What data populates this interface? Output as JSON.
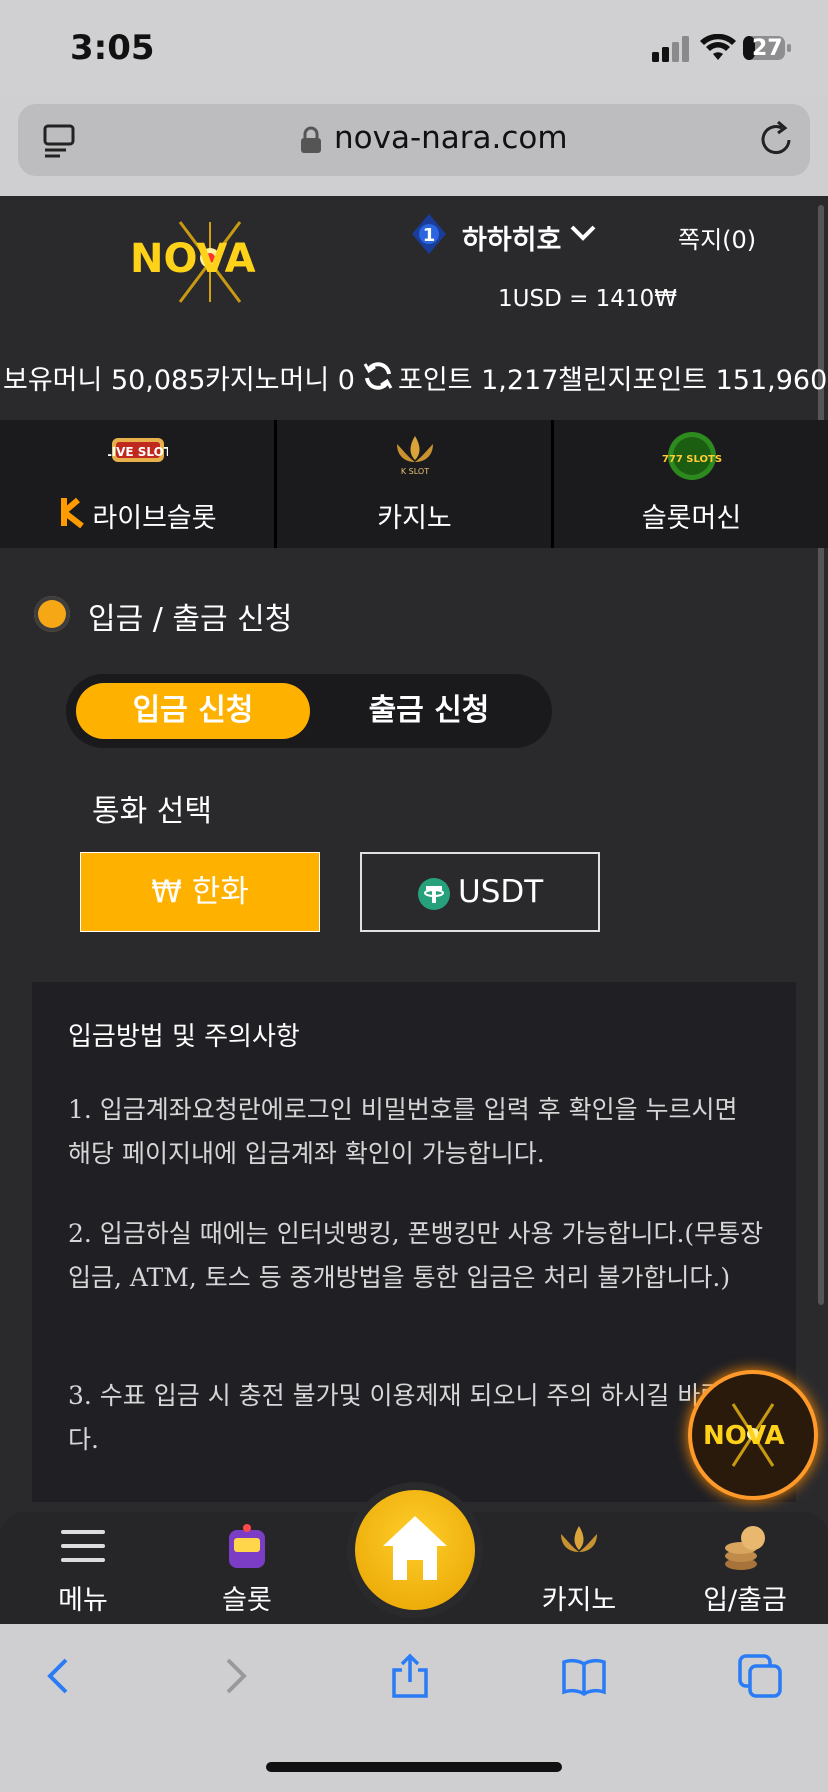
{
  "status_bar": {
    "time": "3:05",
    "battery": "27"
  },
  "browser": {
    "url": "nova-nara.com"
  },
  "header": {
    "logo_text": "NOVA",
    "rank": "1",
    "username": "하하히호",
    "messages": "쪽지(0)",
    "exchange_rate": "1USD = 1410₩"
  },
  "balances": {
    "money": "보유머니 50,085",
    "casino_money": "카지노머니 0",
    "points": "포인트 1,217",
    "challenge_points": "챌린지포인트 151,960"
  },
  "game_nav": [
    {
      "label": "라이브슬롯",
      "icon": "live-slot-icon",
      "badge_text": "LIVE SLOT"
    },
    {
      "label": "카지노",
      "icon": "k-slot-icon",
      "badge_text": "K SLOT"
    },
    {
      "label": "슬롯머신",
      "icon": "777-slots-icon",
      "badge_text": "777 SLOTS"
    }
  ],
  "section": {
    "title": "입금 / 출금 신청",
    "tabs": [
      "입금 신청",
      "출금 신청"
    ],
    "active_tab": "입금 신청",
    "currency_label": "통화 선택",
    "currency_krw": "₩ 한화",
    "currency_usdt": "USDT"
  },
  "notice": {
    "heading": "입금방법 및 주의사항",
    "items": [
      "1. 입금계좌요청란에로그인 비밀번호를 입력 후 확인을 누르시면 해당 페이지내에 입금계좌 확인이 가능합니다.",
      "2. 입금하실 때에는 인터넷뱅킹, 폰뱅킹만 사용 가능합니다.(무통장입금, ATM, 토스 등 중개방법을 통한 입금은 처리 불가합니다.)",
      "3. 수표 입금 시 충전 불가및 이용제재 되오니 주의 하시길 바랍니다."
    ]
  },
  "bottom_nav": [
    "메뉴",
    "슬롯",
    "카지노",
    "입/출금"
  ],
  "colors": {
    "accent": "#ffb100",
    "bg": "#2a2a2d",
    "dark": "#1b1b1d",
    "tether": "#26a17b"
  }
}
